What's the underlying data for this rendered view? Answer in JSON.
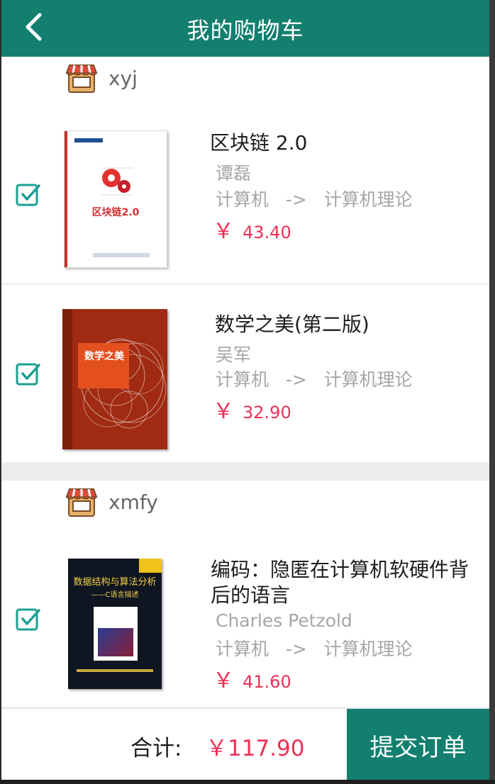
{
  "topbar": {
    "title": "我的购物车",
    "back_icon": "chevron-left-icon"
  },
  "shops": [
    {
      "name": "xyj",
      "items": [
        {
          "title": "区块链 2.0",
          "author": "谭磊",
          "category": "计算机",
          "arrow": "->",
          "subcategory": "计算机理论",
          "currency": "￥",
          "price": "43.40",
          "checked": true,
          "cover_text": "区块链2.0"
        },
        {
          "title": "数学之美(第二版)",
          "author": "吴军",
          "category": "计算机",
          "arrow": "->",
          "subcategory": "计算机理论",
          "currency": "￥",
          "price": "32.90",
          "checked": true,
          "cover_text": "数学之美"
        }
      ]
    },
    {
      "name": "xmfy",
      "items": [
        {
          "title": "编码：隐匿在计算机软硬件背后的语言",
          "author": "Charles Petzold",
          "category": "计算机",
          "arrow": "->",
          "subcategory": "计算机理论",
          "currency": "￥",
          "price": "41.60",
          "checked": true,
          "cover_text": "数据结构与算法分析",
          "cover_subtext": "——C语言描述"
        }
      ]
    }
  ],
  "footer": {
    "total_label": "合计:",
    "total_value": "￥117.90",
    "submit_label": "提交订单"
  },
  "colors": {
    "primary": "#137f6f",
    "price": "#ee2f55",
    "checkbox": "#1aa092"
  }
}
